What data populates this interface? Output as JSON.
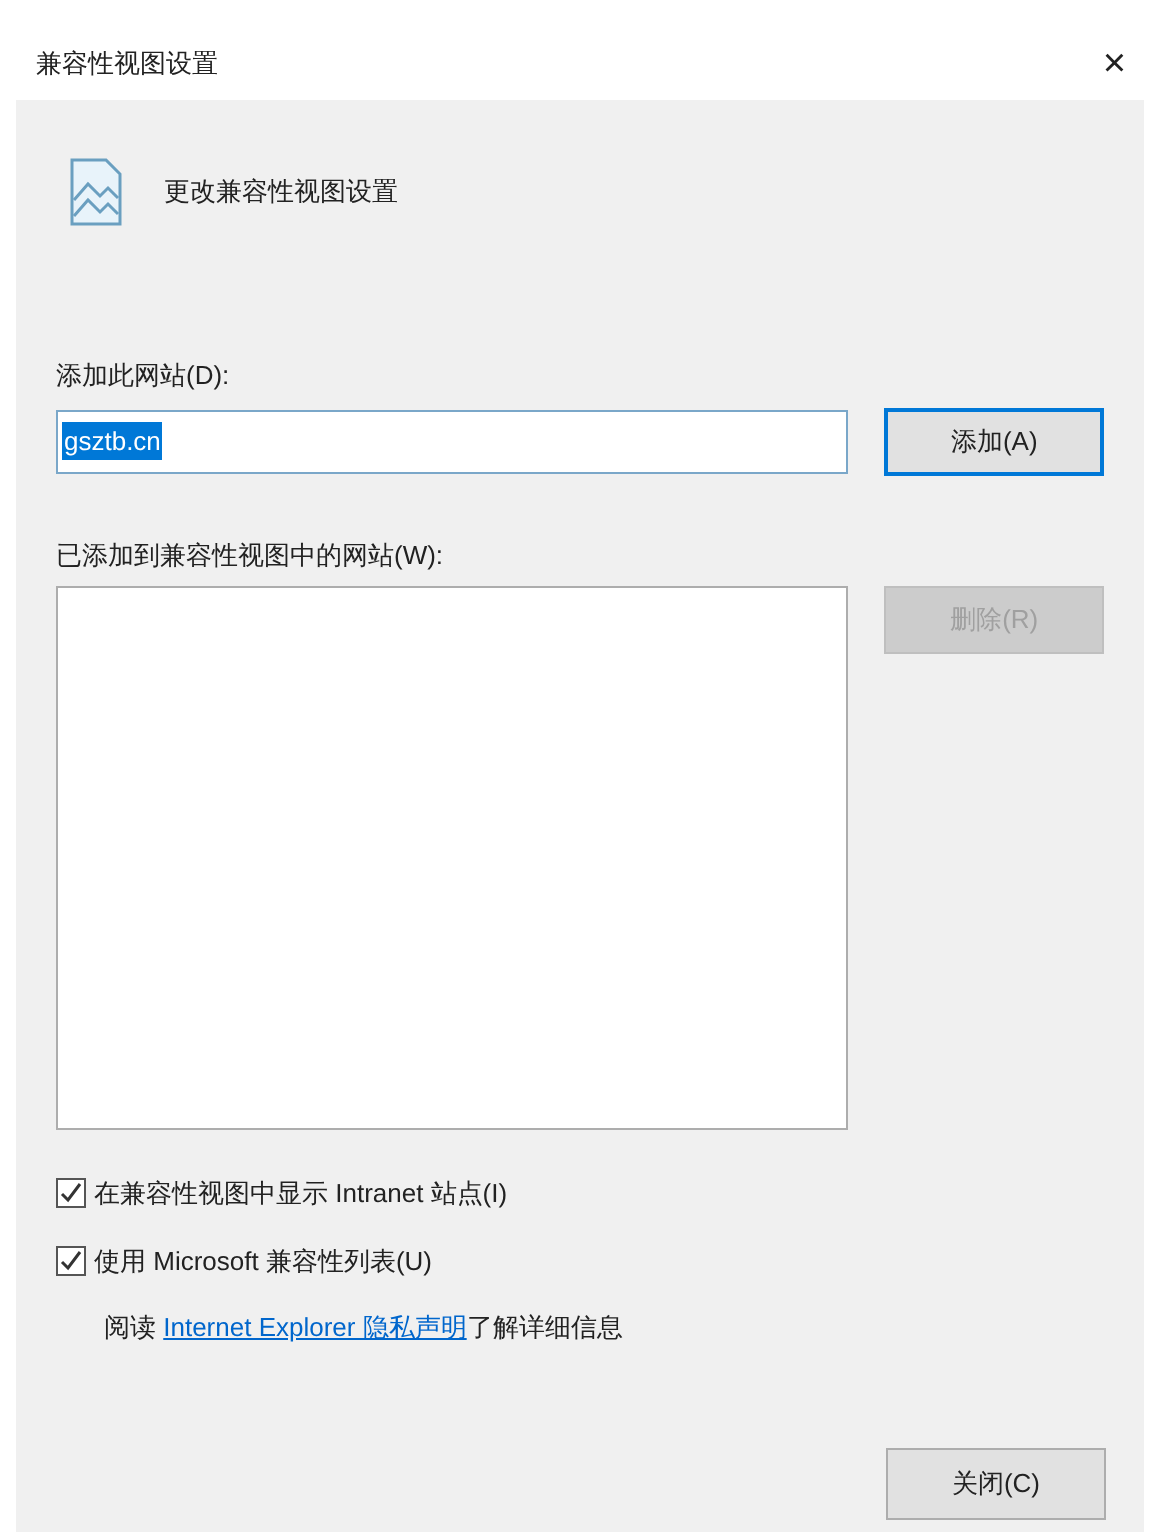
{
  "dialog": {
    "title": "兼容性视图设置",
    "close_glyph": "×",
    "heading": "更改兼容性视图设置",
    "add_label": "添加此网站(D):",
    "add_value": "gsztb.cn",
    "add_button": "添加(A)",
    "list_label": "已添加到兼容性视图中的网站(W):",
    "remove_button": {
      "label": "删除(R)",
      "disabled": true
    },
    "options": [
      {
        "label": "在兼容性视图中显示 Intranet 站点(I)",
        "checked": true
      },
      {
        "label": "使用 Microsoft 兼容性列表(U)",
        "checked": true
      }
    ],
    "info": {
      "before": "阅读 ",
      "link": "Internet Explorer 隐私声明",
      "after": "了解详细信息"
    },
    "close_button": "关闭(C)"
  }
}
